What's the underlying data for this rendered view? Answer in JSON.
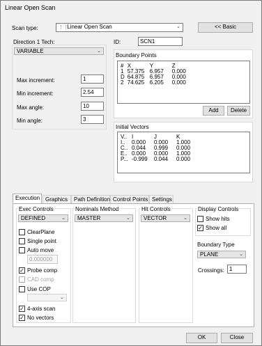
{
  "window": {
    "title": "Linear Open Scan"
  },
  "scan_type": {
    "label": "Scan type:",
    "value": "Linear Open Scan",
    "icon": "scan-icon"
  },
  "basic_button": "<< Basic",
  "id": {
    "label": "ID:",
    "value": "SCN1"
  },
  "direction_tech": {
    "label": "Direction 1 Tech:",
    "value": "VARIABLE"
  },
  "params": [
    {
      "label": "Max increment:",
      "value": "1"
    },
    {
      "label": "Min increment:",
      "value": "2.54"
    },
    {
      "label": "Max angle:",
      "value": "10"
    },
    {
      "label": "Min angle:",
      "value": "3"
    }
  ],
  "boundary_points": {
    "title": "Boundary Points",
    "columns": [
      "#",
      "X",
      "Y",
      "Z"
    ],
    "rows": [
      [
        "1",
        "57.375",
        "6.957",
        "0.000"
      ],
      [
        "D",
        "64.875",
        "6.957",
        "0.000"
      ],
      [
        "2",
        "74.625",
        "6.205",
        "0.000"
      ]
    ],
    "add": "Add",
    "delete": "Delete"
  },
  "initial_vectors": {
    "title": "Initial Vectors",
    "columns": [
      "V..",
      "I",
      "J",
      "K"
    ],
    "rows": [
      [
        "I..",
        "0.000",
        "0.000",
        "1.000"
      ],
      [
        "C..",
        "0.044",
        "0.999",
        "0.000"
      ],
      [
        "E..",
        "0.000",
        "0.000",
        "1.000"
      ],
      [
        "P...",
        "-0.999",
        "0.044",
        "0.000"
      ]
    ]
  },
  "tabs": [
    "Execution",
    "Graphics",
    "Path Definition",
    "Control Points",
    "Settings"
  ],
  "exec_controls": {
    "title": "Exec Controls",
    "mode": "DEFINED",
    "clear_plane": "ClearPlane",
    "single_point": "Single point",
    "auto_move": "Auto move",
    "auto_move_value": "0.000000",
    "probe_comp": "Probe comp",
    "cad_comp": "CAD comp",
    "use_cop": "Use COP",
    "four_axis": "4-axis scan",
    "no_vectors": "No vectors"
  },
  "nominals": {
    "title": "Nominals Method",
    "value": "MASTER"
  },
  "hit_controls": {
    "title": "Hit Controls",
    "value": "VECTOR"
  },
  "display_controls": {
    "title": "Display Controls",
    "show_hits": "Show hits",
    "show_all": "Show all"
  },
  "boundary_type": {
    "title": "Boundary Type",
    "value": "PLANE",
    "crossings_label": "Crossings:",
    "crossings": "1"
  },
  "footer": {
    "ok": "OK",
    "close": "Close"
  }
}
